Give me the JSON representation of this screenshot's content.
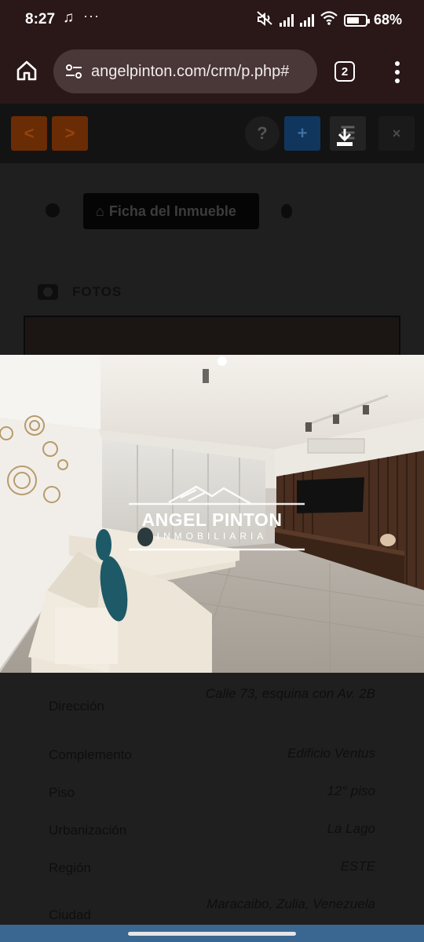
{
  "status_bar": {
    "time": "8:27",
    "battery": "68%",
    "battery_level": 0.68
  },
  "browser": {
    "url": "angelpinton.com/crm/p.php#",
    "tab_count": "2",
    "icons": [
      "home-icon",
      "site-settings-icon",
      "tab-switcher-icon",
      "more-menu-icon"
    ]
  },
  "page": {
    "toolbar": {
      "prev": "<",
      "next": ">",
      "help": "?",
      "add": "+",
      "close": "×",
      "icons": [
        "chevron-left-icon",
        "chevron-right-icon",
        "help-icon",
        "plus-icon",
        "list-icon",
        "download-icon",
        "close-icon"
      ]
    },
    "tabs": {
      "ficha_label": "Ficha del Inmueble"
    },
    "fotos_label": "FOTOS",
    "details": [
      {
        "label": "Dirección",
        "value": "Calle 73, esquina con Av. 2B"
      },
      {
        "label": "Complemento",
        "value": "Edificio Ventus"
      },
      {
        "label": "Piso",
        "value": "12° piso"
      },
      {
        "label": "Urbanización",
        "value": "La Lago"
      },
      {
        "label": "Región",
        "value": "ESTE"
      },
      {
        "label": "Ciudad",
        "value": "Maracaibo, Zulia, Venezuela"
      }
    ]
  },
  "lightbox": {
    "watermark_name": "ANGEL PINTON",
    "watermark_sub": "INMOBILIARIA"
  },
  "colors": {
    "chrome": "#2a1717",
    "url_pill": "#4a3737",
    "nav_bar": "#3a6792"
  }
}
